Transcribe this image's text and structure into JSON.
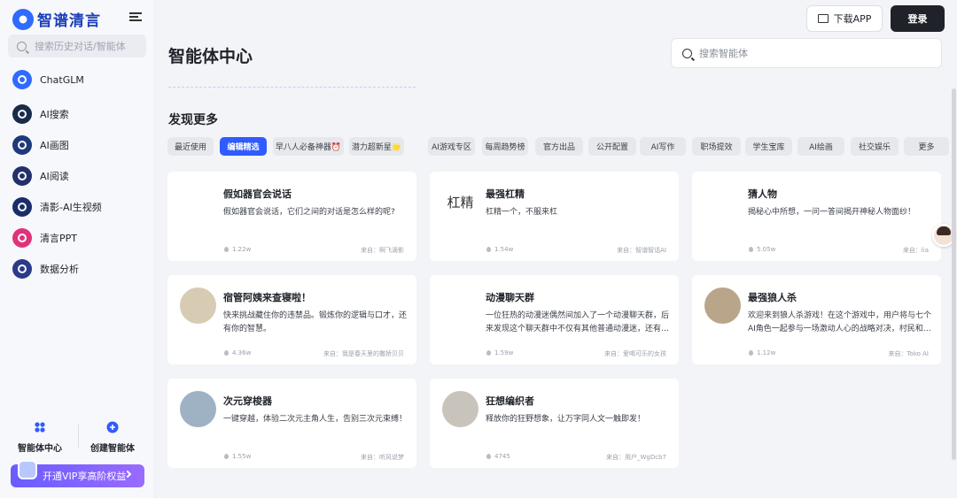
{
  "sidebar": {
    "brand": "智谱清言",
    "search_placeholder": "搜索历史对话/智能体",
    "items": [
      {
        "label": "ChatGLM",
        "icon": "chatglm-logo-icon",
        "color": "#2f6bff"
      },
      {
        "label": "AI搜索",
        "icon": "ai-search-icon",
        "color": "#1a2a4a"
      },
      {
        "label": "AI画图",
        "icon": "ai-draw-icon",
        "color": "#1f3a7a"
      },
      {
        "label": "AI阅读",
        "icon": "ai-read-icon",
        "color": "#22306b"
      },
      {
        "label": "清影-AI生视频",
        "icon": "ai-video-icon",
        "color": "#1b2c6a"
      },
      {
        "label": "清言PPT",
        "icon": "ppt-icon",
        "color": "#e0337a"
      },
      {
        "label": "数据分析",
        "icon": "data-analysis-icon",
        "color": "#2b3a8a"
      }
    ],
    "tools": [
      {
        "label": "智能体中心",
        "icon": "agent-center-icon"
      },
      {
        "label": "创建智能体",
        "icon": "create-agent-icon"
      }
    ],
    "vip_label": "开通VIP享高阶权益"
  },
  "header": {
    "download_label": "下载APP",
    "login_label": "登录"
  },
  "main": {
    "title": "智能体中心",
    "search_placeholder": "搜索智能体",
    "section_title": "发现更多",
    "tabs": [
      {
        "label": "最近使用",
        "active": false
      },
      {
        "label": "编辑精选",
        "active": true
      },
      {
        "label": "早八人必备神器⏰",
        "active": false
      },
      {
        "label": "潜力超新星🌟",
        "active": false
      },
      {
        "label": "AI游戏专区",
        "active": false
      },
      {
        "label": "每周趋势榜",
        "active": false
      },
      {
        "label": "官方出品",
        "active": false
      },
      {
        "label": "公开配置",
        "active": false
      },
      {
        "label": "AI写作",
        "active": false
      },
      {
        "label": "职场提效",
        "active": false
      },
      {
        "label": "学生宝库",
        "active": false
      },
      {
        "label": "AI绘画",
        "active": false
      },
      {
        "label": "社交娱乐",
        "active": false
      },
      {
        "label": "更多",
        "active": false
      }
    ],
    "cards": [
      {
        "name": "假如器官会说话",
        "desc": "假如器官会说话，它们之间的对话是怎么样的呢?",
        "stat": "1.22w",
        "from": "来自：啊飞滴影",
        "avatar": "organ-avatar",
        "avatar_text": ""
      },
      {
        "name": "最强杠精",
        "desc": "杠精一个，不服来杠",
        "stat": "1.54w",
        "from": "来自：智谱智话AI",
        "avatar": "text-avatar",
        "avatar_text": "杠精"
      },
      {
        "name": "猜人物",
        "desc": "揭秘心中所想，一问一答间揭开神秘人物面纱！",
        "stat": "5.05w",
        "from": "来自：lia",
        "avatar": "silhouette-avatar",
        "avatar_text": ""
      },
      {
        "name": "宿管阿姨来查寝啦！",
        "desc": "快来挑战藏住你的违禁品。锻炼你的逻辑与口才，还有你的智慧。",
        "stat": "4.36w",
        "from": "来自：我是春天里的撒娇贝贝",
        "avatar": "dorm-avatar",
        "avatar_text": ""
      },
      {
        "name": "动漫聊天群",
        "desc": "一位狂热的动漫迷偶然间加入了一个动漫聊天群，后来发现这个聊天群中不仅有其他普通动漫迷，还有…",
        "stat": "1.59w",
        "from": "来自：爱喝可乐的女孩",
        "avatar": "anime-avatar",
        "avatar_text": ""
      },
      {
        "name": "最强狼人杀",
        "desc": "欢迎来到狼人杀游戏！在这个游戏中，用户将与七个AI角色一起参与一场激动人心的战略对决，村民和…",
        "stat": "1.12w",
        "from": "来自：Toko AI",
        "avatar": "wolf-avatar",
        "avatar_text": ""
      },
      {
        "name": "次元穿梭器",
        "desc": "一键穿越，体验二次元主角人生，告别三次元束缚！",
        "stat": "1.55w",
        "from": "来自：听风说梦",
        "avatar": "dimension-avatar",
        "avatar_text": ""
      },
      {
        "name": "狂想编织者",
        "desc": "释放你的狂野想象，让万字同人文一触即发！",
        "stat": "4745",
        "from": "来自：用户_WgDcb7",
        "avatar": "weaver-avatar",
        "avatar_text": ""
      }
    ]
  }
}
